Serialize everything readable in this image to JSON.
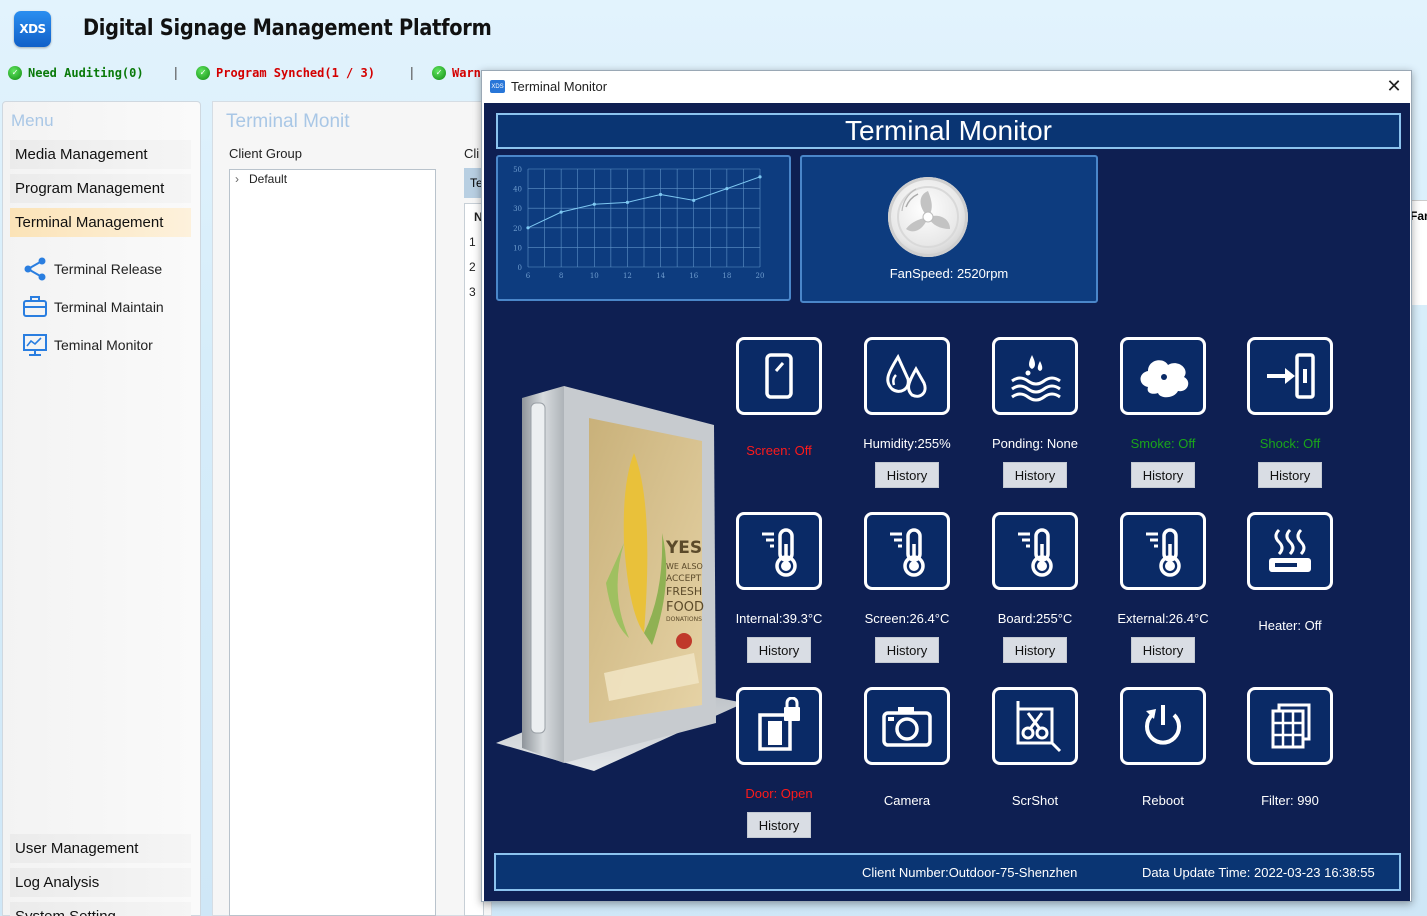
{
  "app": {
    "logo_text": "XDS",
    "title": "Digital Signage Management Platform",
    "status": [
      {
        "label": "Need Auditing(0)",
        "color": "#0a7a0a"
      },
      {
        "label": "Program Synched(1 / 3)",
        "color": "#d40000"
      },
      {
        "label": "Warn",
        "color": "#d40000"
      }
    ],
    "status_separator": "|"
  },
  "menu": {
    "header": "Menu",
    "items": [
      {
        "label": "Media Management"
      },
      {
        "label": "Program Management"
      },
      {
        "label": "Terminal Management"
      }
    ],
    "sub_items": [
      {
        "label": "Terminal Release",
        "icon": "share-icon"
      },
      {
        "label": "Terminal Maintain",
        "icon": "toolbox-icon"
      },
      {
        "label": "Teminal Monitor",
        "icon": "monitor-icon"
      }
    ],
    "bottom_items": [
      {
        "label": "User Management"
      },
      {
        "label": "Log Analysis"
      },
      {
        "label": "System Setting"
      }
    ]
  },
  "content": {
    "title": "Terminal Monit",
    "client_group_label": "Client Group",
    "tree_root": "Default",
    "client_label": "Cli",
    "tab_label": "Te",
    "col_header": "N",
    "row_numbers": [
      "1",
      "2",
      "3"
    ],
    "right_col_header": "Fan"
  },
  "window": {
    "title": "Terminal Monitor",
    "close_glyph": "✕"
  },
  "monitor": {
    "header": "Terminal Monitor",
    "fan_label": "FanSpeed: 2520rpm",
    "history_label": "History",
    "tiles": [
      {
        "label": "Screen: Off",
        "icon": "screen-icon",
        "status": "red",
        "history": false
      },
      {
        "label": "Humidity:255%",
        "icon": "humidity-icon",
        "status": "normal",
        "history": true
      },
      {
        "label": "Ponding: None",
        "icon": "ponding-icon",
        "status": "normal",
        "history": true
      },
      {
        "label": "Smoke: Off",
        "icon": "smoke-icon",
        "status": "green",
        "history": true
      },
      {
        "label": "Shock: Off",
        "icon": "shock-icon",
        "status": "green",
        "history": true
      },
      {
        "label": "Internal:39.3°C",
        "icon": "thermometer-icon",
        "status": "normal",
        "history": true
      },
      {
        "label": "Screen:26.4°C",
        "icon": "thermometer-icon",
        "status": "normal",
        "history": true
      },
      {
        "label": "Board:255°C",
        "icon": "thermometer-icon",
        "status": "normal",
        "history": true
      },
      {
        "label": "External:26.4°C",
        "icon": "thermometer-icon",
        "status": "normal",
        "history": true
      },
      {
        "label": "Heater: Off",
        "icon": "heater-icon",
        "status": "normal",
        "history": false
      },
      {
        "label": "Door: Open",
        "icon": "door-icon",
        "status": "red",
        "history": true
      },
      {
        "label": "Camera",
        "icon": "camera-icon",
        "status": "normal",
        "history": false
      },
      {
        "label": "ScrShot",
        "icon": "screenshot-icon",
        "status": "normal",
        "history": false
      },
      {
        "label": "Reboot",
        "icon": "reboot-icon",
        "status": "normal",
        "history": false
      },
      {
        "label": "Filter: 990",
        "icon": "filter-icon",
        "status": "normal",
        "history": false
      }
    ],
    "footer": {
      "client": "Client Number:Outdoor-75-Shenzhen",
      "update_time": "Data Update Time: 2022-03-23 16:38:55"
    },
    "poster_text": [
      "YES",
      "WE ALSO",
      "ACCEPT",
      "FRESH",
      "FOOD",
      "DONATIONS"
    ]
  },
  "chart_data": {
    "type": "line",
    "x": [
      6,
      8,
      10,
      12,
      14,
      16,
      18,
      20
    ],
    "series": [
      {
        "values": [
          20,
          28,
          32,
          33,
          37,
          34,
          40,
          46
        ]
      }
    ],
    "xticks": [
      "6",
      "8",
      "10",
      "12",
      "14",
      "16",
      "18",
      "20"
    ],
    "yticks": [
      "0",
      "10",
      "20",
      "30",
      "40",
      "50"
    ],
    "xlim": [
      6,
      20
    ],
    "ylim": [
      0,
      50
    ],
    "grid": true,
    "line_color": "#7ec8f2"
  }
}
